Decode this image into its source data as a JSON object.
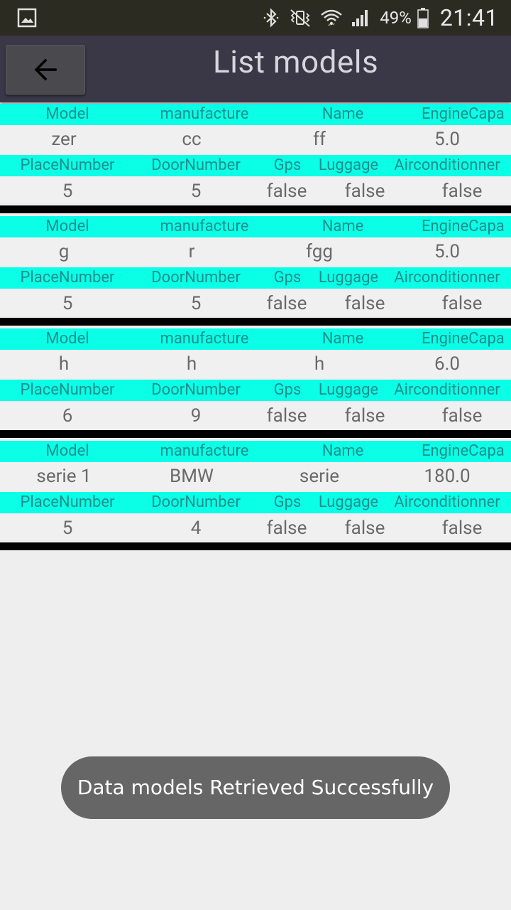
{
  "status_bar": {
    "battery_percent": "49%",
    "time": "21:41",
    "icons": [
      "gallery-icon",
      "bluetooth-icon",
      "vibrate-icon",
      "wifi-icon",
      "signal-icon",
      "battery-icon"
    ]
  },
  "action_bar": {
    "back_icon": "arrow-left-icon",
    "title": "List models"
  },
  "labels": {
    "model": "Model",
    "manufacture": "manufacture",
    "name": "Name",
    "engine": "EngineCapa",
    "place": "PlaceNumber",
    "door": "DoorNumber",
    "gps": "Gps",
    "luggage": "Luggage",
    "aircon": "Airconditionner"
  },
  "models": [
    {
      "model": "zer",
      "manufacture": "cc",
      "name": "ff",
      "engine": "5.0",
      "place": "5",
      "door": "5",
      "gps": "false",
      "luggage": "false",
      "aircon": "false"
    },
    {
      "model": "g",
      "manufacture": "r",
      "name": "fgg",
      "engine": "5.0",
      "place": "5",
      "door": "5",
      "gps": "false",
      "luggage": "false",
      "aircon": "false"
    },
    {
      "model": "h",
      "manufacture": "h",
      "name": "h",
      "engine": "6.0",
      "place": "6",
      "door": "9",
      "gps": "false",
      "luggage": "false",
      "aircon": "false"
    },
    {
      "model": "serie 1",
      "manufacture": "BMW",
      "name": "serie",
      "engine": "180.0",
      "place": "5",
      "door": "4",
      "gps": "false",
      "luggage": "false",
      "aircon": "false"
    }
  ],
  "toast": {
    "message": "Data models Retrieved Successfully"
  },
  "colors": {
    "header_bg": "#0affe6",
    "header_text": "#1f8f8c",
    "action_bar": "#3a3747",
    "status_bar": "#2b2b21"
  }
}
